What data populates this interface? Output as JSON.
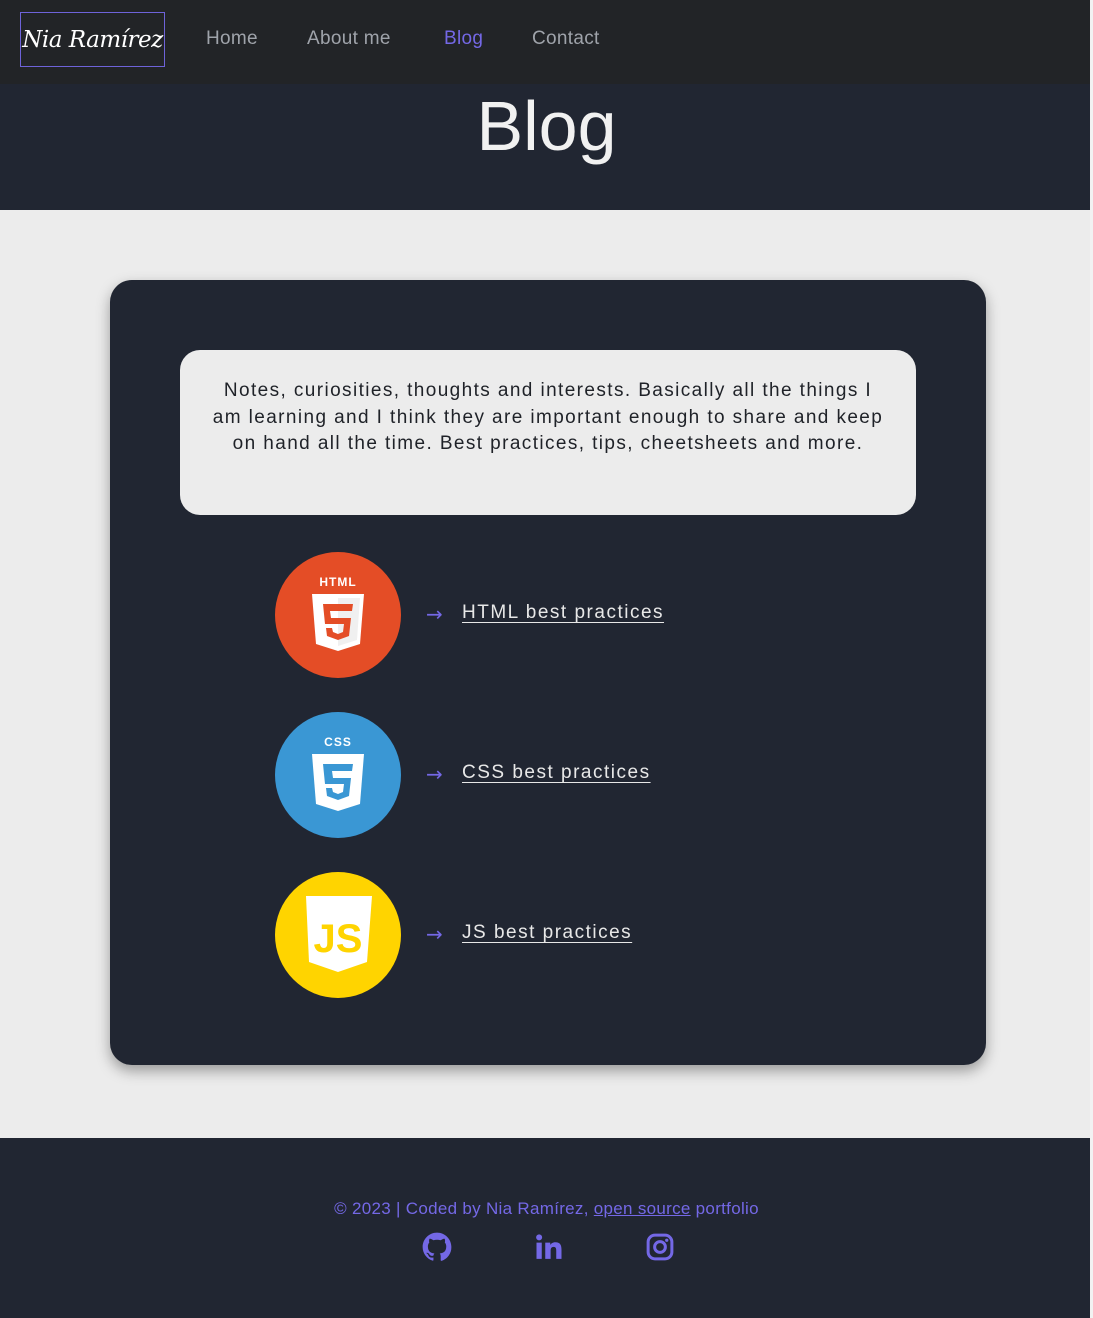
{
  "header": {
    "logo": "Nia Ramírez",
    "nav": [
      "Home",
      "About me",
      "Blog",
      "Contact"
    ],
    "active": "Blog"
  },
  "hero": {
    "title": "Blog"
  },
  "intro": "Notes, curiosities, thoughts and interests. Basically all the things I am learning and I think they are important enough to share and keep on hand all the time. Best practices, tips, cheetsheets and more.",
  "entries": [
    {
      "label": "HTML best practices",
      "icon": "html5-icon",
      "badge_text": "HTML",
      "color": "#e44d26"
    },
    {
      "label": "CSS best practices",
      "icon": "css3-icon",
      "badge_text": "CSS",
      "color": "#3a97d4"
    },
    {
      "label": "JS best practices",
      "icon": "js-icon",
      "badge_text": "JS",
      "color": "#ffd400"
    }
  ],
  "arrow": "→",
  "footer": {
    "prefix": "© 2023 | Coded by Nia Ramírez, ",
    "link": "open source",
    "suffix": " portfolio",
    "social": [
      "github-icon",
      "linkedin-icon",
      "instagram-icon"
    ]
  },
  "colors": {
    "accent": "#7468e6",
    "dark": "#212632",
    "light": "#ececec"
  }
}
